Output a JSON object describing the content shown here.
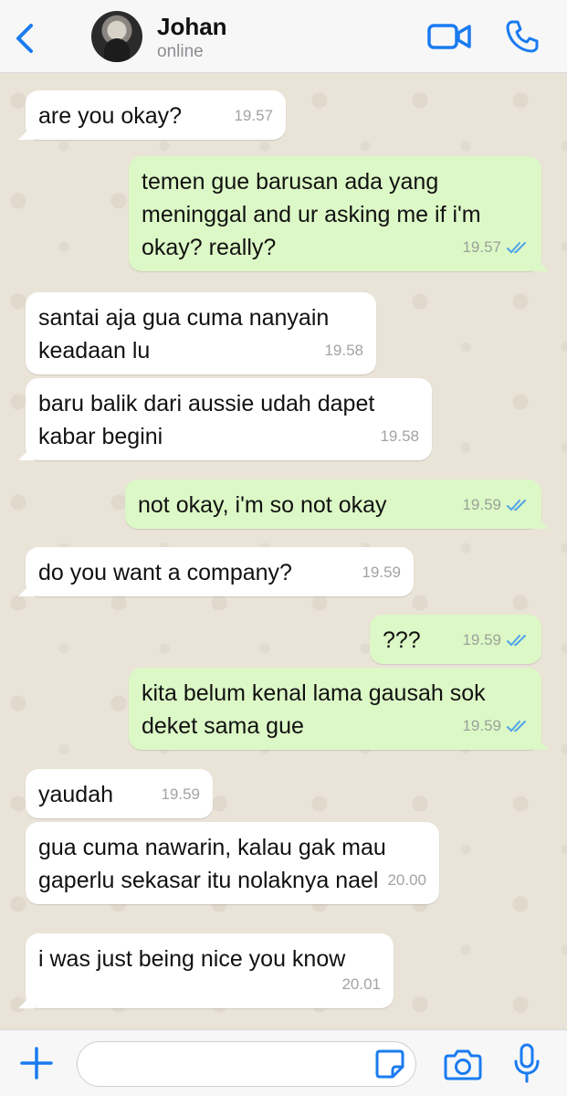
{
  "header": {
    "contact_name": "Johan",
    "status": "online"
  },
  "icons": {
    "back": "chevron-left-icon",
    "video": "video-camera-icon",
    "call": "phone-icon",
    "plus": "plus-icon",
    "sticker": "sticker-icon",
    "camera": "camera-icon",
    "mic": "microphone-icon",
    "read": "double-check-icon"
  },
  "colors": {
    "accent": "#1a7bf0",
    "incoming_bubble": "#ffffff",
    "outgoing_bubble": "#dcf8c6",
    "read_tick": "#4fa3e8"
  },
  "messages": [
    {
      "direction": "in",
      "text": "are you okay?",
      "time": "19.57"
    },
    {
      "direction": "out",
      "text": "temen gue barusan ada yang\nmeninggal and ur asking me if i'm\nokay? really?",
      "time": "19.57",
      "read": true
    },
    {
      "direction": "in",
      "text": "santai aja gua cuma nanyain\nkeadaan lu",
      "time": "19.58"
    },
    {
      "direction": "in",
      "text": "baru balik dari aussie udah dapet\nkabar begini",
      "time": "19.58"
    },
    {
      "direction": "out",
      "text": "not okay, i'm so not okay",
      "time": "19.59",
      "read": true
    },
    {
      "direction": "in",
      "text": "do you want a company?",
      "time": "19.59"
    },
    {
      "direction": "out",
      "text": "???",
      "time": "19.59",
      "read": true
    },
    {
      "direction": "out",
      "text": "kita belum kenal lama gausah sok\ndeket sama gue",
      "time": "19.59",
      "read": true
    },
    {
      "direction": "in",
      "text": "yaudah",
      "time": "19.59"
    },
    {
      "direction": "in",
      "text": "gua cuma nawarin, kalau gak mau\ngaperlu sekasar itu nolaknya nael",
      "time": "20.00"
    },
    {
      "direction": "in",
      "text": "i was just being nice you know",
      "time": "20.01"
    }
  ],
  "composer": {
    "value": "",
    "placeholder": ""
  }
}
